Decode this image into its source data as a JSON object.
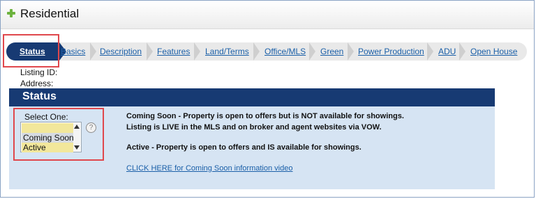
{
  "header": {
    "title": "Residential",
    "icon": "plus-icon"
  },
  "tabs": {
    "active": "Status",
    "items": [
      "Basics",
      "Description",
      "Features",
      "Land/Terms",
      "Office/MLS",
      "Green",
      "Power Production",
      "ADU",
      "Open House"
    ]
  },
  "listing": {
    "id_label": "Listing ID:",
    "address_label": "Address:"
  },
  "section": {
    "title": "Status"
  },
  "status_select": {
    "label": "Select One:",
    "options": [
      "",
      "Coming Soon",
      "Active"
    ],
    "help_glyph": "?"
  },
  "descriptions": {
    "coming_soon_1": "Coming Soon - Property is open to offers but is NOT available for showings.",
    "coming_soon_2": "Listing is LIVE in the MLS and on broker and agent websites via VOW.",
    "active": "Active - Property is open to offers and IS available for showings."
  },
  "video_link": "CLICK HERE for Coming Soon information video",
  "colors": {
    "nav_active": "#173a73",
    "section_bg": "#d6e4f3",
    "highlight": "#e0474c",
    "link": "#1a5fa8"
  }
}
